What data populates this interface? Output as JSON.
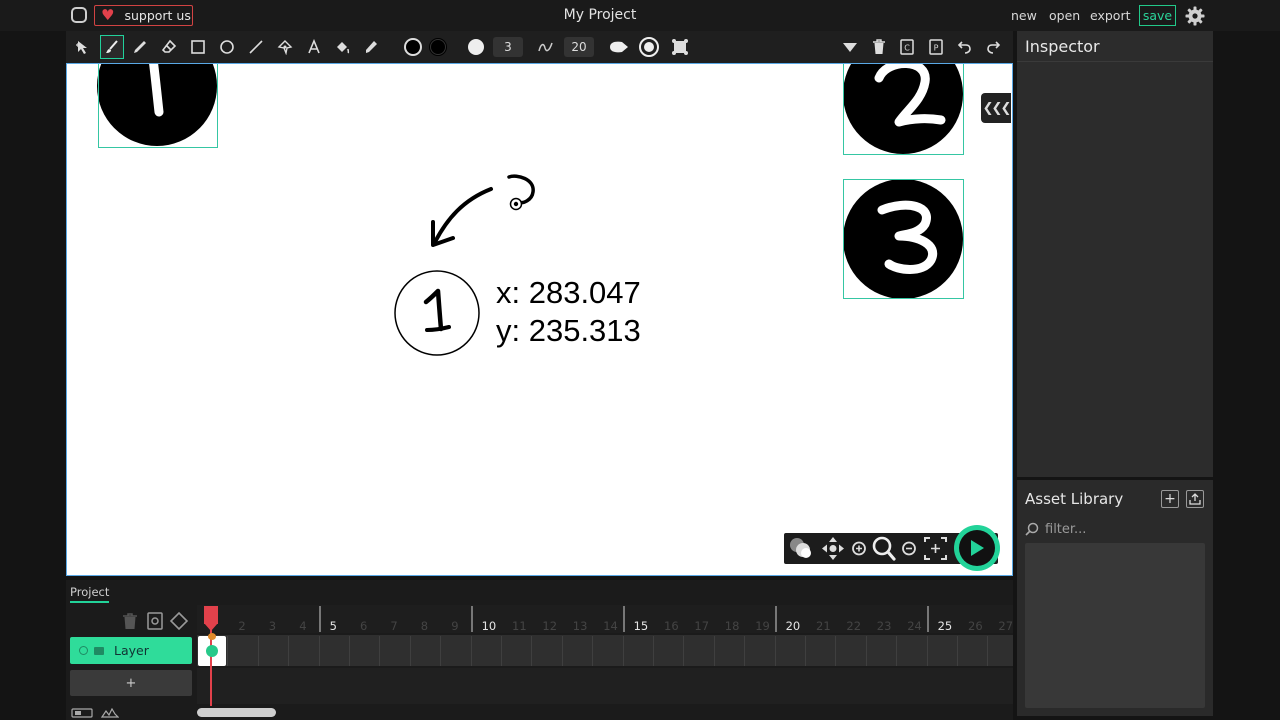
{
  "app": {
    "project_title": "My Project",
    "support_label": "support us",
    "menu": {
      "new": "new",
      "open": "open",
      "export": "export",
      "save": "save"
    }
  },
  "toolbar": {
    "stroke_size": "3",
    "smoothing": "20"
  },
  "stage": {
    "coord_x": "x: 283.047",
    "coord_y": "y: 235.313",
    "accent_color": "#35c6a3"
  },
  "inspector": {
    "title": "Inspector"
  },
  "assets": {
    "title": "Asset Library",
    "filter_placeholder": "filter..."
  },
  "timeline": {
    "tab": "Project",
    "layer_name": "Layer",
    "add_layer": "+",
    "frames": [
      "5",
      "10",
      "15",
      "20",
      "25"
    ],
    "minor_frames": [
      "2",
      "3",
      "4",
      "6",
      "7",
      "8",
      "9",
      "11",
      "12",
      "13",
      "14",
      "16",
      "17",
      "18",
      "19",
      "21",
      "22",
      "23",
      "24",
      "26",
      "27"
    ]
  },
  "colors": {
    "accent": "#22d399",
    "danger": "#e2414b"
  }
}
